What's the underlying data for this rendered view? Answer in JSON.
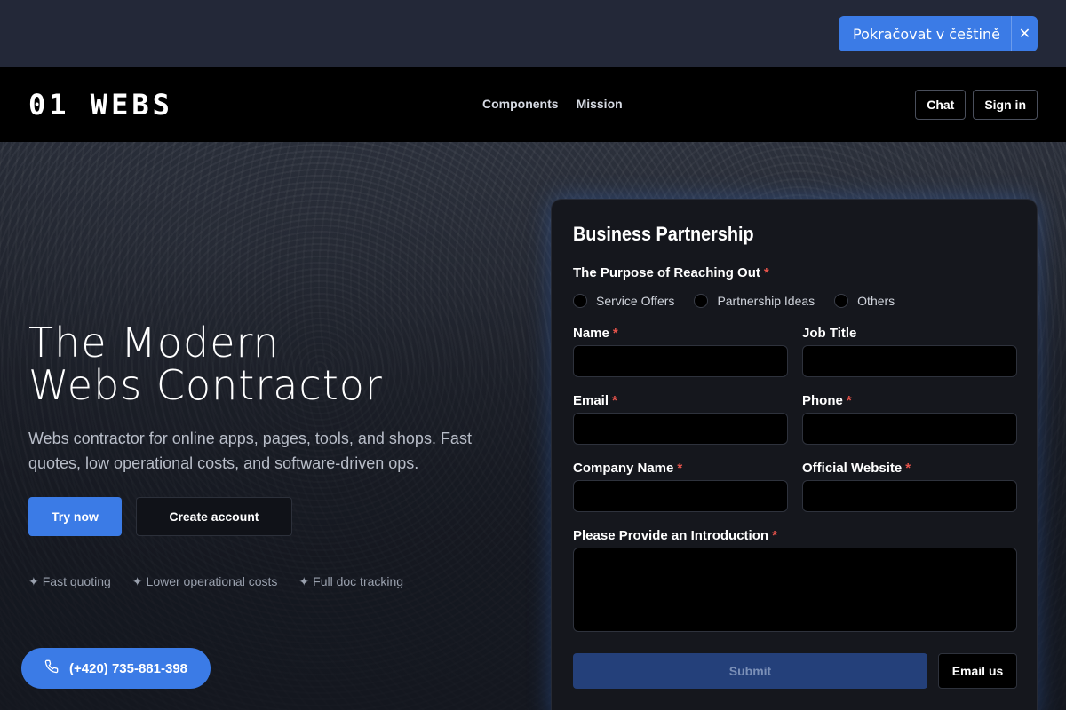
{
  "language_banner": {
    "label": "Pokračovat v češtině",
    "close_glyph": "✕"
  },
  "header": {
    "logo": "01 WEBS",
    "nav": [
      "Components",
      "Mission"
    ],
    "chat_label": "Chat",
    "signin_label": "Sign in"
  },
  "hero": {
    "title_line1": "The Modern",
    "title_line2": "Webs Contractor",
    "subtitle": "Webs contractor for online apps, pages, tools, and shops. Fast quotes, low operational costs, and software-driven ops.",
    "cta_primary": "Try now",
    "cta_secondary": "Create account",
    "features": [
      "Fast quoting",
      "Lower operational costs",
      "Full doc tracking"
    ],
    "feature_icon": "✦",
    "phone": "(+420) 735-881-398"
  },
  "form": {
    "title": "Business Partnership",
    "purpose_label": "The Purpose of Reaching Out",
    "purpose_options": [
      "Service Offers",
      "Partnership Ideas",
      "Others"
    ],
    "required_mark": "*",
    "name_label": "Name",
    "job_title_label": "Job Title",
    "email_label": "Email",
    "phone_label": "Phone",
    "company_label": "Company Name",
    "website_label": "Official Website",
    "intro_label": "Please Provide an Introduction",
    "submit_label": "Submit",
    "email_us_label": "Email us"
  },
  "colors": {
    "accent": "#3b7be6",
    "required": "#e5534b",
    "submit_disabled": "#24407a"
  }
}
